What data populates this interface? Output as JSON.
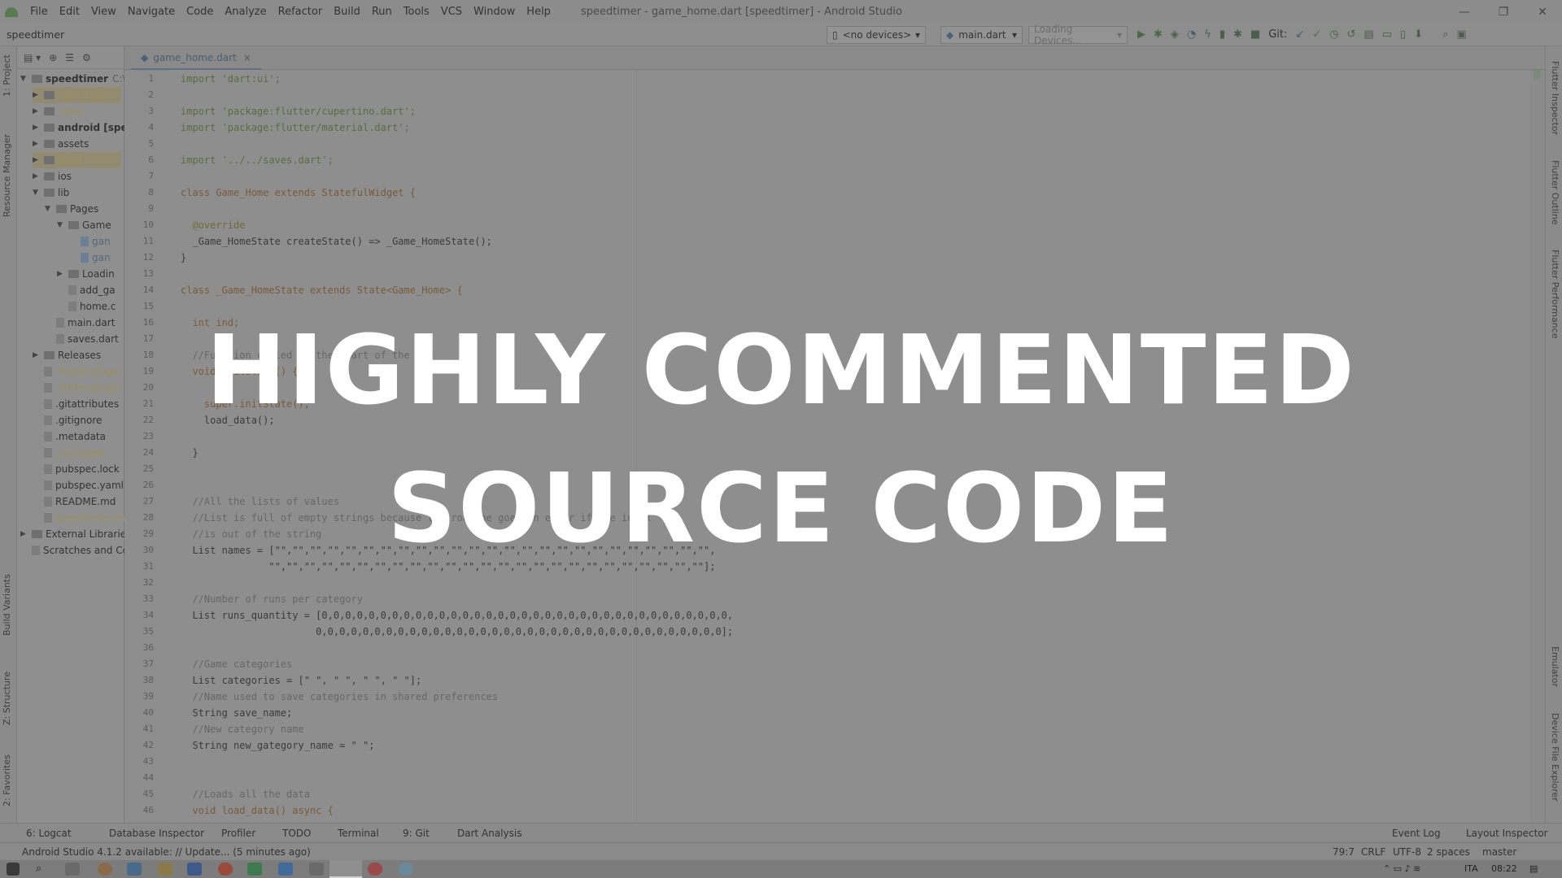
{
  "window": {
    "title": "speedtimer - game_home.dart [speedtimer] - Android Studio",
    "controls": [
      "—",
      "❐",
      "✕"
    ]
  },
  "menu": [
    "File",
    "Edit",
    "View",
    "Navigate",
    "Code",
    "Analyze",
    "Refactor",
    "Build",
    "Run",
    "Tools",
    "VCS",
    "Window",
    "Help"
  ],
  "toolbar": {
    "breadcrumb": "speedtimer",
    "device": "<no devices>",
    "config": "main.dart",
    "loading": "Loading Devices...",
    "git_label": "Git:"
  },
  "left_strip": [
    "1: Project",
    "Resource Manager",
    "Build Variants",
    "Z: Structure",
    "2: Favorites"
  ],
  "right_strip": [
    "Flutter Inspector",
    "Flutter Outline",
    "Flutter Performance",
    "Emulator",
    "Device File Explorer"
  ],
  "project_tree": [
    {
      "label": "speedtimer",
      "extra": "C:\\U",
      "depth": 0,
      "type": "folder",
      "open": true,
      "style": "bold"
    },
    {
      "label": ".dart_tool",
      "depth": 1,
      "type": "folder",
      "open": false,
      "style": "ign2"
    },
    {
      "label": ".idea",
      "depth": 1,
      "type": "folder",
      "open": false,
      "style": "ign"
    },
    {
      "label": "android [spee",
      "depth": 1,
      "type": "folder",
      "open": false,
      "style": "bold"
    },
    {
      "label": "assets",
      "depth": 1,
      "type": "folder",
      "open": false,
      "style": ""
    },
    {
      "label": "build",
      "depth": 1,
      "type": "folder",
      "open": false,
      "style": "ign2"
    },
    {
      "label": "ios",
      "depth": 1,
      "type": "folder",
      "open": false,
      "style": ""
    },
    {
      "label": "lib",
      "depth": 1,
      "type": "folder",
      "open": true,
      "style": ""
    },
    {
      "label": "Pages",
      "depth": 2,
      "type": "folder",
      "open": true,
      "style": ""
    },
    {
      "label": "Game",
      "depth": 3,
      "type": "folder",
      "open": true,
      "style": ""
    },
    {
      "label": "gan",
      "depth": 4,
      "type": "file",
      "style": "blue"
    },
    {
      "label": "gan",
      "depth": 4,
      "type": "file",
      "style": "blue"
    },
    {
      "label": "Loadin",
      "depth": 3,
      "type": "folder",
      "open": false,
      "style": ""
    },
    {
      "label": "add_ga",
      "depth": 3,
      "type": "file",
      "style": ""
    },
    {
      "label": "home.c",
      "depth": 3,
      "type": "file",
      "style": ""
    },
    {
      "label": "main.dart",
      "depth": 2,
      "type": "file",
      "style": ""
    },
    {
      "label": "saves.dart",
      "depth": 2,
      "type": "file",
      "style": ""
    },
    {
      "label": "Releases",
      "depth": 1,
      "type": "folder",
      "open": false,
      "style": ""
    },
    {
      "label": ".flutter-plugin",
      "depth": 1,
      "type": "file",
      "style": "ign"
    },
    {
      "label": ".flutter-plugin",
      "depth": 1,
      "type": "file",
      "style": "ign"
    },
    {
      "label": ".gitattributes",
      "depth": 1,
      "type": "file",
      "style": ""
    },
    {
      "label": ".gitignore",
      "depth": 1,
      "type": "file",
      "style": ""
    },
    {
      "label": ".metadata",
      "depth": 1,
      "type": "file",
      "style": ""
    },
    {
      "label": ".packages",
      "depth": 1,
      "type": "file",
      "style": "ign"
    },
    {
      "label": "pubspec.lock",
      "depth": 1,
      "type": "file",
      "style": ""
    },
    {
      "label": "pubspec.yaml",
      "depth": 1,
      "type": "file",
      "style": ""
    },
    {
      "label": "README.md",
      "depth": 1,
      "type": "file",
      "style": ""
    },
    {
      "label": "speedtimer.im",
      "depth": 1,
      "type": "file",
      "style": "ign"
    },
    {
      "label": "External Libraries",
      "depth": 0,
      "type": "folder",
      "open": false,
      "style": ""
    },
    {
      "label": "Scratches and Co",
      "depth": 0,
      "type": "file",
      "style": ""
    }
  ],
  "editor": {
    "tab": "game_home.dart",
    "lines": [
      "import 'dart:ui';",
      "",
      "import 'package:flutter/cupertino.dart';",
      "import 'package:flutter/material.dart';",
      "",
      "import '../../saves.dart';",
      "",
      "class Game_Home extends StatefulWidget {",
      "",
      "  @override",
      "  _Game_HomeState createState() => _Game_HomeState();",
      "}",
      "",
      "class _Game_HomeState extends State<Game_Home> {",
      "",
      "  int ind;",
      "",
      "  //Function called at the start of the app",
      "  void initState() {",
      "",
      "    super.initState();",
      "    load_data();",
      "",
      "  }",
      "",
      "",
      "  //All the lists of values",
      "  //List is full of empty strings because the routine goes in error if the index",
      "  //is out of the string",
      "  List names = [\"\",\"\",\"\",\"\",\"\",\"\",\"\",\"\",\"\",\"\",\"\",\"\",\"\",\"\",\"\",\"\",\"\",\"\",\"\",\"\",\"\",\"\",\"\",\"\",\"\",",
      "               \"\",\"\",\"\",\"\",\"\",\"\",\"\",\"\",\"\",\"\",\"\",\"\",\"\",\"\",\"\",\"\",\"\",\"\",\"\",\"\",\"\",\"\",\"\",\"\",\"\"];",
      "",
      "  //Number of runs per category",
      "  List runs_quantity = [0,0,0,0,0,0,0,0,0,0,0,0,0,0,0,0,0,0,0,0,0,0,0,0,0,0,0,0,0,0,0,0,0,0,0,",
      "                       0,0,0,0,0,0,0,0,0,0,0,0,0,0,0,0,0,0,0,0,0,0,0,0,0,0,0,0,0,0,0,0,0,0,0];",
      "",
      "  //Game categories",
      "  List categories = [\" \", \" \", \" \", \" \"];",
      "  //Name used to save categories in shared preferences",
      "  String save_name;",
      "  //New category name",
      "  String new_gategory_name = \" \";",
      "",
      "",
      "  //Loads all the data",
      "  void load_data() async {"
    ]
  },
  "bottom_tools": [
    "6: Logcat",
    "Database Inspector",
    "Profiler",
    "TODO",
    "Terminal",
    "9: Git",
    "Dart Analysis"
  ],
  "bottom_tools_right": [
    "Event Log",
    "Layout Inspector"
  ],
  "status": {
    "message": "Android Studio 4.1.2 available: // Update... (5 minutes ago)",
    "position": "79:7",
    "line_sep": "CRLF",
    "encoding": "UTF-8",
    "indent": "2 spaces",
    "branch": "master"
  },
  "taskbar": {
    "lang": "ITA",
    "time": "08:22"
  },
  "overlay": {
    "line1": "HIGHLY COMMENTED",
    "line2": "SOURCE CODE"
  }
}
